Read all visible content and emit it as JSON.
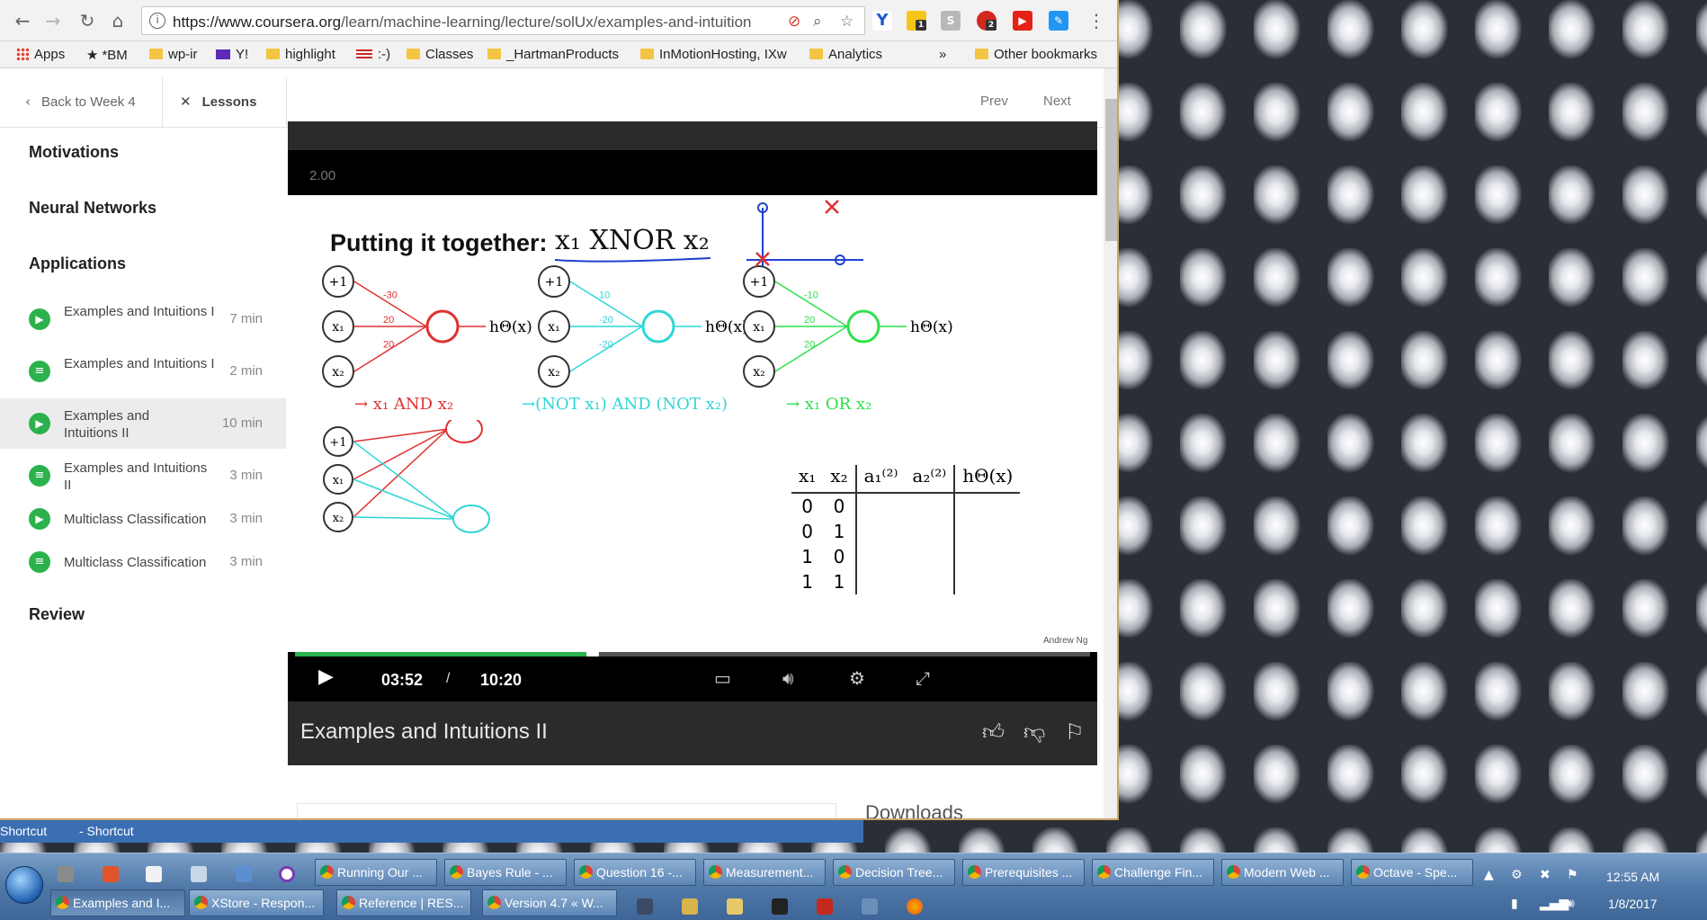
{
  "browser": {
    "url_host": "https://www.coursera.org",
    "url_path": "/learn/machine-learning/lecture/solUx/examples-and-intuition",
    "bookmarks": [
      {
        "label": "Apps"
      },
      {
        "label": "*BM"
      },
      {
        "label": "wp-ir"
      },
      {
        "label": "Y!"
      },
      {
        "label": "highlight"
      },
      {
        "label": ":-)"
      },
      {
        "label": "Classes"
      },
      {
        "label": "_HartmanProducts"
      },
      {
        "label": "InMotionHosting, IXw"
      },
      {
        "label": "Analytics"
      }
    ],
    "bookmarks_overflow": "»",
    "other_bookmarks": "Other bookmarks",
    "badges": {
      "ext1": "1",
      "ext2": "2"
    }
  },
  "page": {
    "back_label": "Back to Week 4",
    "lessons_label": "Lessons",
    "prev_label": "Prev",
    "next_label": "Next",
    "downloads_heading": "Downloads"
  },
  "sidebar": {
    "sections": [
      "Motivations",
      "Neural Networks",
      "Applications",
      "Review"
    ],
    "lessons": [
      {
        "title": "Examples and Intuitions I",
        "duration": "7 min",
        "kind": "video",
        "active": false
      },
      {
        "title": "Examples and Intuitions I",
        "duration": "2 min",
        "kind": "reading",
        "active": false
      },
      {
        "title": "Examples and Intuitions II",
        "duration": "10 min",
        "kind": "video",
        "active": true
      },
      {
        "title": "Examples and Intuitions II",
        "duration": "3 min",
        "kind": "reading",
        "active": false
      },
      {
        "title": "Multiclass Classification",
        "duration": "3 min",
        "kind": "video",
        "active": false
      },
      {
        "title": "Multiclass Classification",
        "duration": "3 min",
        "kind": "reading",
        "active": false
      }
    ]
  },
  "player": {
    "speed": "2.00",
    "current_time": "03:52",
    "time_separator": "/",
    "total_time": "10:20",
    "progress_fraction": 0.374,
    "video_title": "Examples and Intuitions II",
    "slide": {
      "title": "Putting it together:",
      "title_math": "x₁ XNOR x₂",
      "author": "Andrew Ng",
      "net_and": {
        "label": "→ x₁ AND x₂",
        "weights": [
          "-30",
          "20",
          "20"
        ],
        "out": "hΘ(x)",
        "color": "#e03030"
      },
      "net_not": {
        "label": "→(NOT x₁) AND (NOT x₂)",
        "weights": [
          "10",
          "-20",
          "-20"
        ],
        "out": "hΘ(x)",
        "color": "#2fd6d6"
      },
      "net_or": {
        "label": "→ x₁ OR x₂",
        "weights": [
          "-10",
          "20",
          "20"
        ],
        "out": "hΘ(x)",
        "color": "#2ee04a"
      },
      "inputs": [
        "+1",
        "x₁",
        "x₂"
      ],
      "table": {
        "headers": [
          "x₁",
          "x₂",
          "a₁⁽²⁾",
          "a₂⁽²⁾",
          "hΘ(x)"
        ],
        "rows": [
          [
            "0",
            "0"
          ],
          [
            "0",
            "1"
          ],
          [
            "1",
            "0"
          ],
          [
            "1",
            "1"
          ]
        ]
      }
    }
  },
  "taskbar": {
    "shortcut_labels": [
      "Shortcut",
      "- Shortcut"
    ],
    "row1": [
      "Running Our ...",
      "Bayes Rule - ...",
      "Question 16 -...",
      "Measurement...",
      "Decision Tree...",
      "Prerequisites ...",
      "Challenge Fin...",
      "Modern Web ...",
      "Octave - Spe..."
    ],
    "row2": [
      "Examples and I...",
      "XStore - Respon...",
      "Reference | RES...",
      "Version 4.7 « W..."
    ],
    "time": "12:55 AM",
    "date": "1/8/2017"
  }
}
